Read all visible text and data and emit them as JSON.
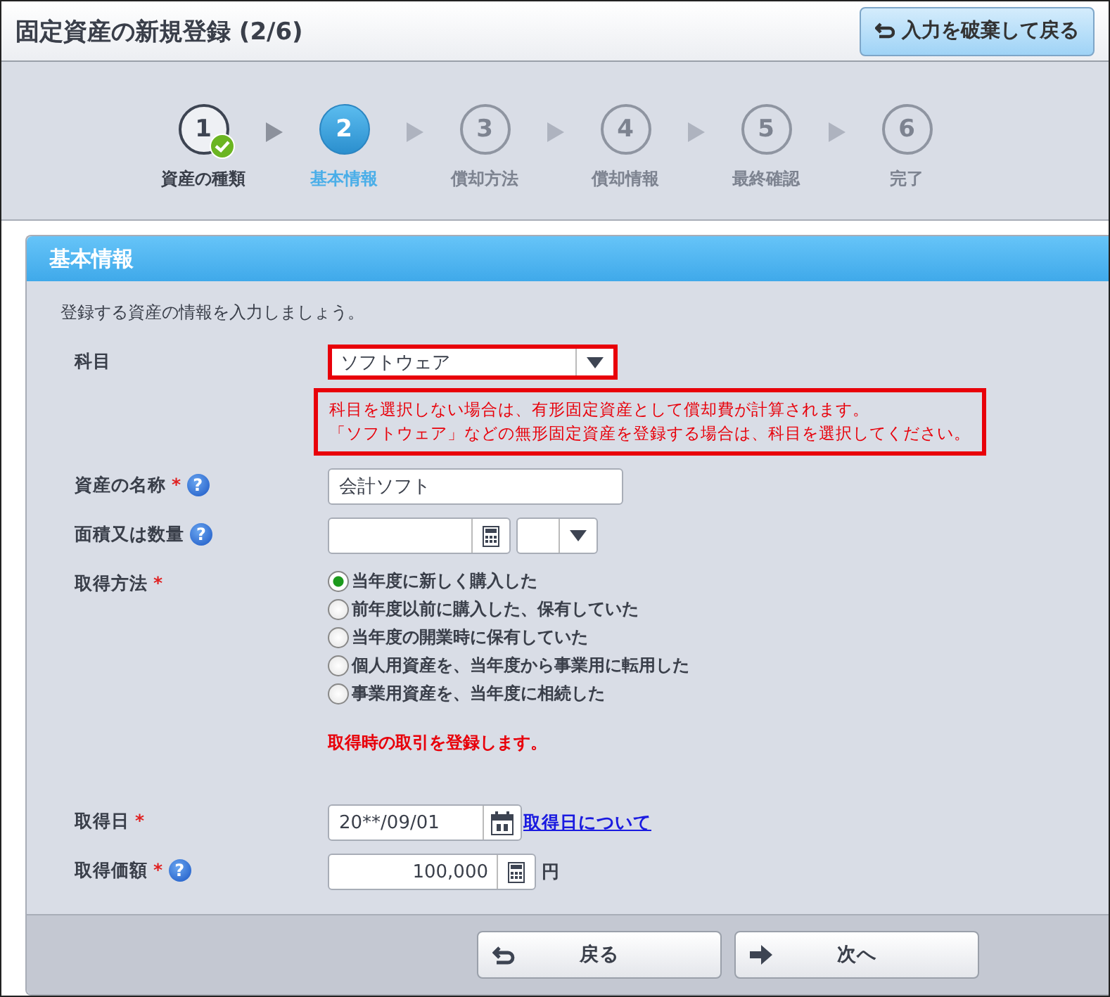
{
  "title": "固定資産の新規登録 (2/6)",
  "discard_button": "入力を破棄して戻る",
  "steps": [
    {
      "number": "1",
      "label": "資産の種類",
      "completed": true,
      "selected": false
    },
    {
      "number": "2",
      "label": "基本情報",
      "completed": false,
      "selected": true
    },
    {
      "number": "3",
      "label": "償却方法",
      "completed": false,
      "selected": false
    },
    {
      "number": "4",
      "label": "償却情報",
      "completed": false,
      "selected": false
    },
    {
      "number": "5",
      "label": "最終確認",
      "completed": false,
      "selected": false
    },
    {
      "number": "6",
      "label": "完了",
      "completed": false,
      "selected": false
    }
  ],
  "section": {
    "title": "基本情報",
    "intro": "登録する資産の情報を入力しましょう。"
  },
  "fields": [
    {
      "kind": "select",
      "label": "科目",
      "value": "ソフトウェア",
      "highlighted": true,
      "notice": [
        "科目を選択しない場合は、有形固定資産として償却費が計算されます。",
        "「ソフトウェア」などの無形固定資産を登録する場合は、科目を選択してください。"
      ]
    },
    {
      "kind": "text",
      "label": "資産の名称",
      "required_mark": "*",
      "help": "?",
      "value": "会計ソフト"
    },
    {
      "kind": "quantity",
      "label": "面積又は数量",
      "help": "?"
    },
    {
      "kind": "radio",
      "label": "取得方法",
      "required_mark": "*",
      "options": [
        {
          "label": "当年度に新しく購入した",
          "selected": true
        },
        {
          "label": "前年度以前に購入した、保有していた",
          "selected": false
        },
        {
          "label": "当年度の開業時に保有していた",
          "selected": false
        },
        {
          "label": "個人用資産を、当年度から事業用に転用した",
          "selected": false
        },
        {
          "label": "事業用資産を、当年度に相続した",
          "selected": false
        }
      ],
      "note": "取得時の取引を登録します。"
    },
    {
      "kind": "date",
      "label": "取得日",
      "required_mark": "*",
      "value": "20**/09/01",
      "link": "取得日について"
    },
    {
      "kind": "amount",
      "label": "取得価額",
      "required_mark": "*",
      "help": "?",
      "value": "100,000",
      "unit": "円"
    }
  ],
  "buttons": [
    "戻る",
    "次へ"
  ]
}
